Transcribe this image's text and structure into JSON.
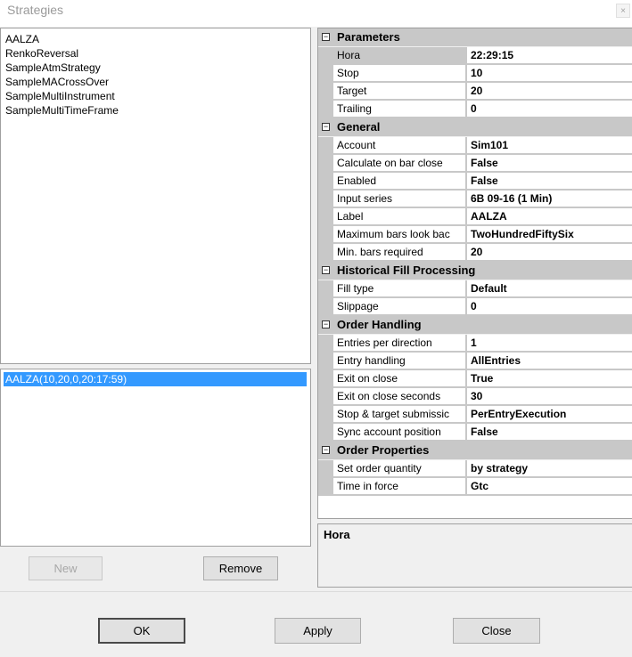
{
  "window": {
    "title": "Strategies",
    "close_glyph": "×"
  },
  "strategies": [
    "AALZA",
    "RenkoReversal",
    "SampleAtmStrategy",
    "SampleMACrossOver",
    "SampleMultiInstrument",
    "SampleMultiTimeFrame"
  ],
  "configured": [
    "AALZA(10,20,0,20:17:59)"
  ],
  "buttons": {
    "new": "New",
    "remove": "Remove",
    "ok": "OK",
    "apply": "Apply",
    "close": "Close"
  },
  "expander_glyph": "−",
  "properties": {
    "parameters": {
      "label": "Parameters",
      "rows": [
        {
          "name": "Hora",
          "value": "22:29:15"
        },
        {
          "name": "Stop",
          "value": "10"
        },
        {
          "name": "Target",
          "value": "20"
        },
        {
          "name": "Trailing",
          "value": "0"
        }
      ]
    },
    "general": {
      "label": "General",
      "rows": [
        {
          "name": "Account",
          "value": "Sim101"
        },
        {
          "name": "Calculate on bar close",
          "value": "False"
        },
        {
          "name": "Enabled",
          "value": "False"
        },
        {
          "name": "Input series",
          "value": "6B 09-16 (1 Min)"
        },
        {
          "name": "Label",
          "value": "AALZA"
        },
        {
          "name": "Maximum bars look bac",
          "value": "TwoHundredFiftySix"
        },
        {
          "name": "Min. bars required",
          "value": "20"
        }
      ]
    },
    "historical": {
      "label": "Historical Fill Processing",
      "rows": [
        {
          "name": "Fill type",
          "value": "Default"
        },
        {
          "name": "Slippage",
          "value": "0"
        }
      ]
    },
    "order_handling": {
      "label": "Order Handling",
      "rows": [
        {
          "name": "Entries per direction",
          "value": "1"
        },
        {
          "name": "Entry handling",
          "value": "AllEntries"
        },
        {
          "name": "Exit on close",
          "value": "True"
        },
        {
          "name": "Exit on close seconds",
          "value": "30"
        },
        {
          "name": "Stop & target submissic",
          "value": "PerEntryExecution"
        },
        {
          "name": "Sync account position",
          "value": "False"
        }
      ]
    },
    "order_properties": {
      "label": "Order Properties",
      "rows": [
        {
          "name": "Set order quantity",
          "value": "by strategy"
        },
        {
          "name": "Time in force",
          "value": "Gtc"
        }
      ]
    }
  },
  "description": {
    "title": "Hora"
  }
}
